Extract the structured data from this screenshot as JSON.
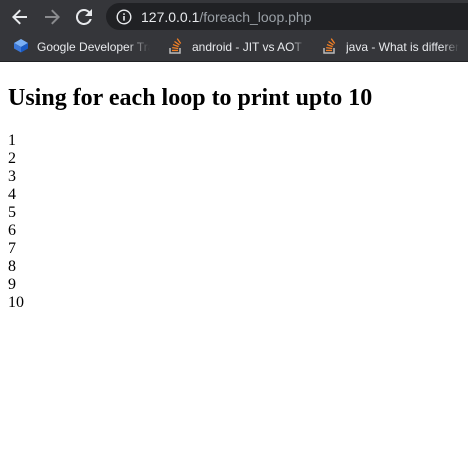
{
  "browser": {
    "url_host": "127.0.0.1",
    "url_path": "/foreach_loop.php",
    "bookmarks": [
      {
        "label": "Google Developer Training",
        "icon": "google-developers-icon"
      },
      {
        "label": "android - JIT vs AOT Compilation",
        "icon": "stackoverflow-icon"
      },
      {
        "label": "java - What is difference",
        "icon": "stackoverflow-icon"
      }
    ]
  },
  "page": {
    "heading": "Using for each loop to print upto 10",
    "lines": [
      "1",
      "2",
      "3",
      "4",
      "5",
      "6",
      "7",
      "8",
      "9",
      "10"
    ]
  }
}
